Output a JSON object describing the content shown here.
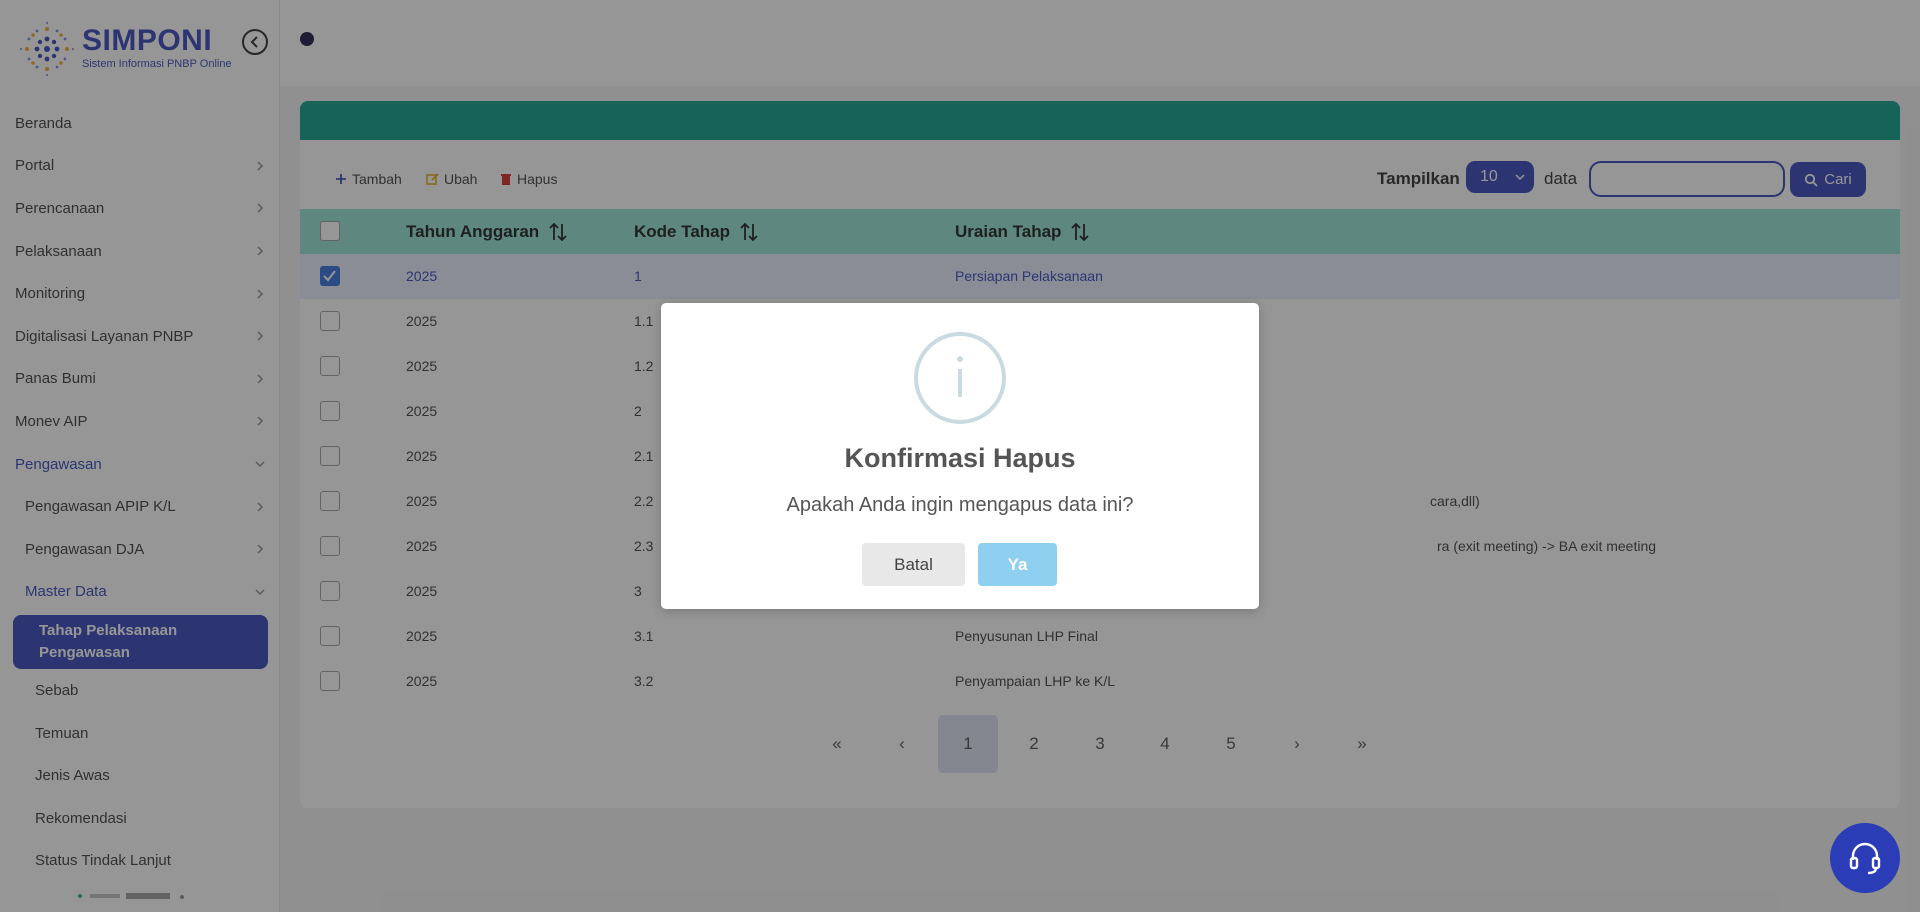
{
  "brand": {
    "title": "SIMPONI",
    "subtitle": "Sistem Informasi PNBP Online"
  },
  "sidebar": {
    "items": [
      {
        "label": "Beranda"
      },
      {
        "label": "Portal"
      },
      {
        "label": "Perencanaan"
      },
      {
        "label": "Pelaksanaan"
      },
      {
        "label": "Monitoring"
      },
      {
        "label": "Digitalisasi Layanan PNBP"
      },
      {
        "label": "Panas Bumi"
      },
      {
        "label": "Monev AIP"
      },
      {
        "label": "Pengawasan"
      },
      {
        "label": "Pengawasan APIP K/L"
      },
      {
        "label": "Pengawasan DJA"
      },
      {
        "label": "Master Data"
      },
      {
        "label_line1": "Tahap Pelaksanaan",
        "label_line2": "Pengawasan"
      },
      {
        "label": "Sebab"
      },
      {
        "label": "Temuan"
      },
      {
        "label": "Jenis Awas"
      },
      {
        "label": "Rekomendasi"
      },
      {
        "label": "Status Tindak Lanjut"
      }
    ]
  },
  "toolbar": {
    "add_label": "Tambah",
    "edit_label": "Ubah",
    "delete_label": "Hapus",
    "show_label": "Tampilkan",
    "page_size": "10",
    "data_label": "data",
    "search_value": "",
    "search_button": "Cari"
  },
  "table": {
    "columns": [
      "Tahun Anggaran",
      "Kode Tahap",
      "Uraian Tahap"
    ],
    "rows": [
      {
        "tahun": "2025",
        "kode": "1",
        "uraian": "Persiapan Pelaksanaan",
        "checked": true
      },
      {
        "tahun": "2025",
        "kode": "1.1",
        "uraian": ""
      },
      {
        "tahun": "2025",
        "kode": "1.2",
        "uraian": ""
      },
      {
        "tahun": "2025",
        "kode": "2",
        "uraian": ""
      },
      {
        "tahun": "2025",
        "kode": "2.1",
        "uraian": ""
      },
      {
        "tahun": "2025",
        "kode": "2.2",
        "uraian": "cara,dll)"
      },
      {
        "tahun": "2025",
        "kode": "2.3",
        "uraian": "ra (exit meeting) -> BA exit meeting"
      },
      {
        "tahun": "2025",
        "kode": "3",
        "uraian": ""
      },
      {
        "tahun": "2025",
        "kode": "3.1",
        "uraian": "Penyusunan LHP Final"
      },
      {
        "tahun": "2025",
        "kode": "3.2",
        "uraian": "Penyampaian LHP ke K/L"
      }
    ]
  },
  "pagination": {
    "first": "«",
    "prev": "‹",
    "pages": [
      "1",
      "2",
      "3",
      "4",
      "5"
    ],
    "current": "1",
    "next": "›",
    "last": "»"
  },
  "modal": {
    "icon": "info-icon",
    "title": "Konfirmasi Hapus",
    "message": "Apakah Anda ingin mengapus data ini?",
    "cancel_label": "Batal",
    "confirm_label": "Ya"
  },
  "colors": {
    "primary": "#2a3db6",
    "header_teal": "#009880",
    "table_header": "#8fe0d2",
    "confirm_button": "#8fd0f0"
  }
}
